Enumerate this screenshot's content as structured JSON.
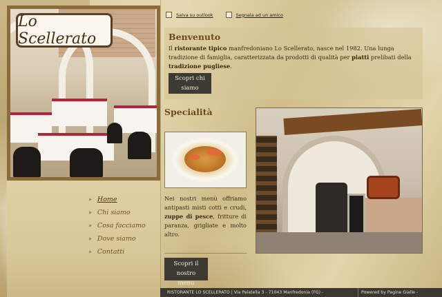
{
  "logo": {
    "text": "Lo Scellerato"
  },
  "toplinks": [
    {
      "label": "Salva su outlook",
      "icon": "calendar-icon"
    },
    {
      "label": "Segnala ad un amico",
      "icon": "share-icon"
    }
  ],
  "welcome": {
    "title": "Benvenuto",
    "p_1": "Il ",
    "p_b1": "ristorante tipico",
    "p_2": " manfredoniano Lo Scellerato, nasce nel 1982. Una lunga tradizione di famiglia, caratterizzata da prodotti di qualità per ",
    "p_b2": "piatti",
    "p_3": " prelibati della ",
    "p_b3": "tradizione pugliese",
    "p_4": ".",
    "button_line1": "Scopri chi",
    "button_line2": "siamo"
  },
  "specialita": {
    "title": "Specialità",
    "text_1": "Nei nostri menù offriamo antipasti misti cotti e crudi, ",
    "text_b": "zuppe di pesce",
    "text_2": ", fritture di paranza, grigliate e molto altro.",
    "button_line1": "Scopri il nostro",
    "button_line2": "menu"
  },
  "nav": [
    {
      "label": "Home",
      "active": true
    },
    {
      "label": "Chi siamo",
      "active": false
    },
    {
      "label": "Cosa facciamo",
      "active": false
    },
    {
      "label": "Dove siamo",
      "active": false
    },
    {
      "label": "Contatti",
      "active": false
    }
  ],
  "footer": {
    "address": "RISTORANTE LO SCELLERATO | Via Palatella 3 - 71043 Manfredonia (FG) -",
    "powered": "Powered by  Pagine Gialle -"
  },
  "colors": {
    "accent": "#6a4a1a",
    "button_bg": "#3d3a33",
    "footer_bg": "#3b3833"
  }
}
